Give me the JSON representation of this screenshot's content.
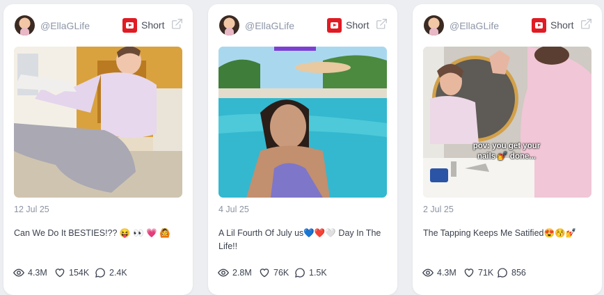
{
  "cards": [
    {
      "handle": "@EllaGLife",
      "type": "Short",
      "date": "12 Jul 25",
      "title": "Can We Do It BESTIES!?? 😝 👀 💗 🙆",
      "views": "4.3M",
      "likes": "154K",
      "comments": "2.4K"
    },
    {
      "handle": "@EllaGLife",
      "type": "Short",
      "date": "4 Jul 25",
      "title": "A Lil Fourth Of July us💙❤️🤍 Day In The Life!!",
      "views": "2.8M",
      "likes": "76K",
      "comments": "1.5K"
    },
    {
      "handle": "@EllaGLife",
      "type": "Short",
      "date": "2 Jul 25",
      "title": "The Tapping Keeps Me Satified😍😚💅",
      "views": "4.3M",
      "likes": "71K",
      "comments": "856",
      "thumb_caption": "pov: you get your nails 💅 done..."
    }
  ],
  "colors": {
    "background": "#eceef2",
    "card": "#ffffff",
    "youtube_red": "#e01b23",
    "muted_text": "#8b93a1"
  },
  "icons": [
    "avatar",
    "youtube-icon",
    "external-link-icon",
    "eye-icon",
    "heart-icon",
    "comment-icon"
  ]
}
